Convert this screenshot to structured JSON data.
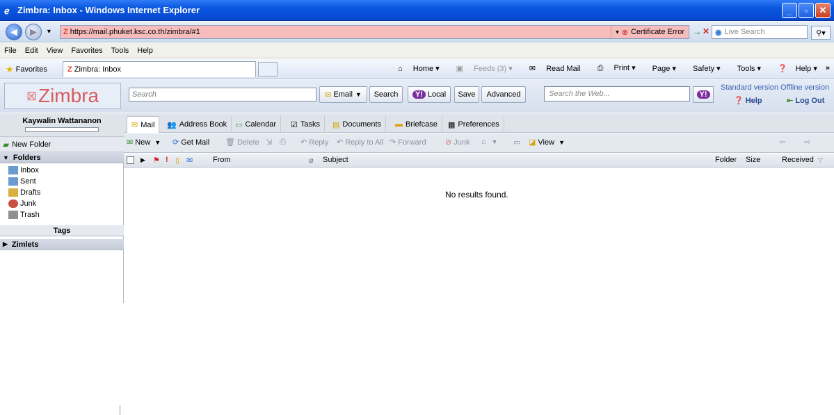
{
  "window": {
    "title": "Zimbra: Inbox - Windows Internet Explorer",
    "url": "https://mail.phuket.ksc.co.th/zimbra/#1",
    "cert_error": "Certificate Error",
    "live_search_placeholder": "Live Search"
  },
  "menu": [
    "File",
    "Edit",
    "View",
    "Favorites",
    "Tools",
    "Help"
  ],
  "favorites_bar": {
    "favorites_label": "Favorites",
    "tab_title": "Zimbra: Inbox",
    "commands": [
      "Home",
      "Feeds (3)",
      "Read Mail",
      "Print",
      "Page",
      "Safety",
      "Tools",
      "Help"
    ]
  },
  "zimbra_header": {
    "logo": "Zimbra",
    "search_placeholder": "Search",
    "email_dropdown": "Email",
    "search_button": "Search",
    "local_button": "Local",
    "save_button": "Save",
    "advanced_button": "Advanced",
    "web_search_placeholder": "Search the Web...",
    "standard_version": "Standard version",
    "offline_version": "Offline version",
    "help_link": "Help",
    "logout_link": "Log Out"
  },
  "sidebar": {
    "user_name": "Kaywalin Wattananon",
    "new_folder": "New Folder",
    "folders_header": "Folders",
    "folders": [
      "Inbox",
      "Sent",
      "Drafts",
      "Junk",
      "Trash"
    ],
    "tags_header": "Tags",
    "zimlets_header": "Zimlets"
  },
  "app_tabs": [
    "Mail",
    "Address Book",
    "Calendar",
    "Tasks",
    "Documents",
    "Briefcase",
    "Preferences"
  ],
  "toolbar": {
    "new": "New",
    "get_mail": "Get Mail",
    "delete": "Delete",
    "reply": "Reply",
    "reply_all": "Reply to All",
    "forward": "Forward",
    "junk": "Junk",
    "view": "View"
  },
  "list_columns": {
    "from": "From",
    "subject": "Subject",
    "folder": "Folder",
    "size": "Size",
    "received": "Received"
  },
  "empty_message": "No results found.",
  "colors": {
    "title_bar": "#0a56e0",
    "address_bar_error": "#f7bcbc",
    "zimbra_logo": "#d85c5c"
  }
}
